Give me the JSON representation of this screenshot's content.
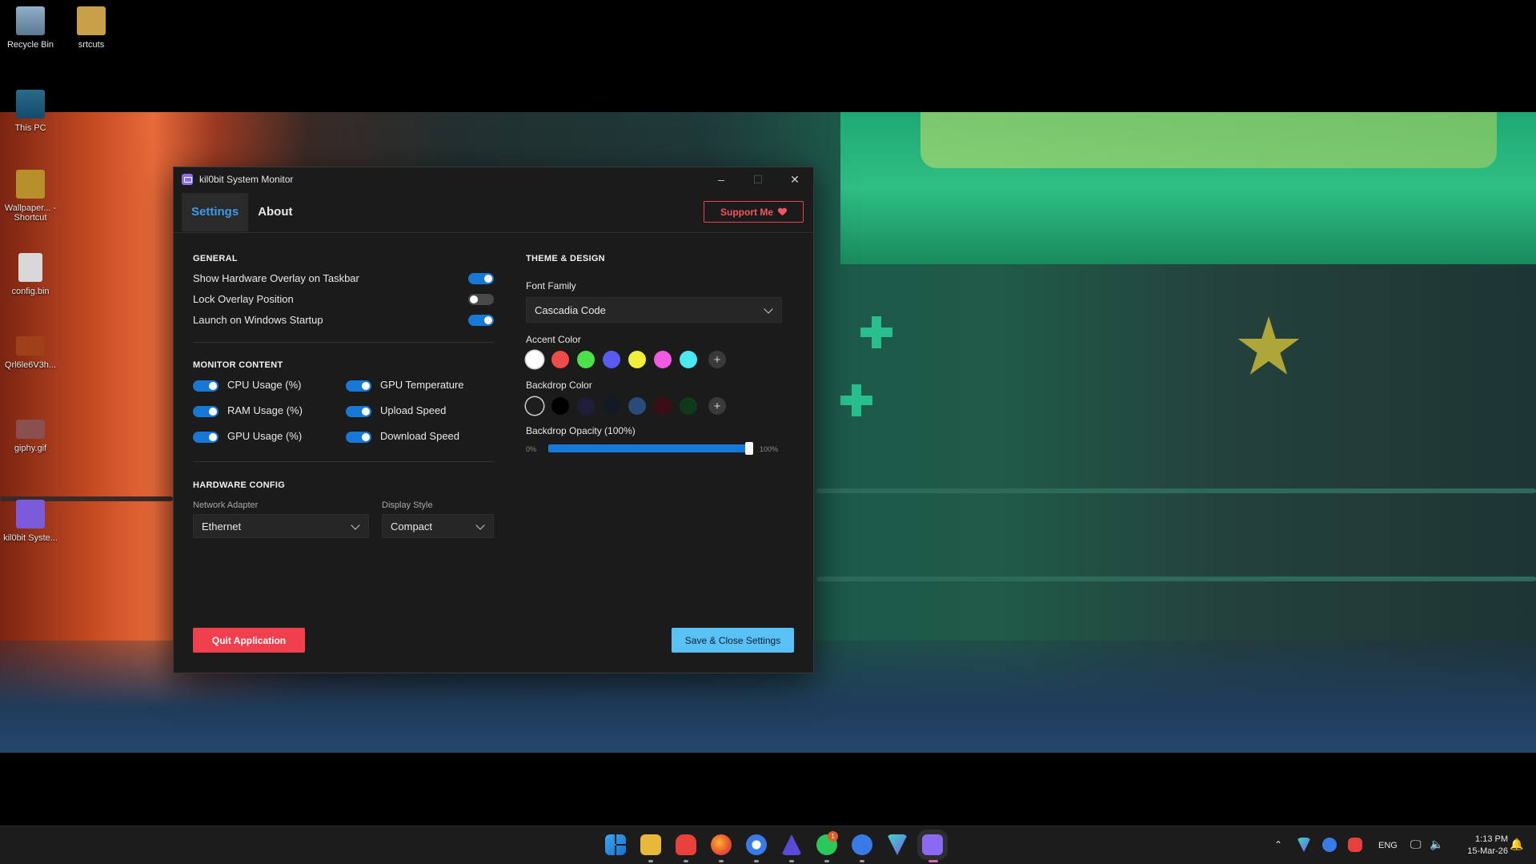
{
  "desktop": {
    "icons": [
      {
        "label": "Recycle Bin"
      },
      {
        "label": "srtcuts"
      },
      {
        "label": "This PC"
      },
      {
        "label": "Wallpaper... - Shortcut"
      },
      {
        "label": "config.bin"
      },
      {
        "label": "Qrl6le6V3h..."
      },
      {
        "label": "giphy.gif"
      },
      {
        "label": "kil0bit Syste..."
      }
    ]
  },
  "window": {
    "title": "kil0bit System Monitor",
    "controls": {
      "minimize": "–",
      "maximize": "☐",
      "close": "✕"
    }
  },
  "nav": {
    "tabs": [
      {
        "label": "Settings",
        "active": true
      },
      {
        "label": "About",
        "active": false
      }
    ],
    "support_label": "Support Me"
  },
  "general": {
    "title": "GENERAL",
    "options": [
      {
        "label": "Show Hardware Overlay on Taskbar",
        "on": true
      },
      {
        "label": "Lock Overlay Position",
        "on": false
      },
      {
        "label": "Launch on Windows Startup",
        "on": true
      }
    ]
  },
  "monitor": {
    "title": "MONITOR CONTENT",
    "left": [
      {
        "label": "CPU Usage (%)",
        "on": true
      },
      {
        "label": "RAM Usage (%)",
        "on": true
      },
      {
        "label": "GPU Usage (%)",
        "on": true
      }
    ],
    "right": [
      {
        "label": "GPU Temperature",
        "on": true
      },
      {
        "label": "Upload Speed",
        "on": true
      },
      {
        "label": "Download Speed",
        "on": true
      }
    ]
  },
  "hardware": {
    "title": "HARDWARE CONFIG",
    "network_label": "Network Adapter",
    "network_value": "Ethernet",
    "display_label": "Display Style",
    "display_value": "Compact"
  },
  "theme": {
    "title": "THEME & DESIGN",
    "font_label": "Font Family",
    "font_value": "Cascadia Code",
    "accent_label": "Accent Color",
    "accent_colors": [
      "#ffffff",
      "#f04a4a",
      "#4ce04a",
      "#5a5af0",
      "#f0f03a",
      "#f05ae0",
      "#4ae8f0"
    ],
    "backdrop_label": "Backdrop Color",
    "backdrop_colors": [
      "#1e1e1e",
      "#000000",
      "#1e1e3a",
      "#141a24",
      "#2a4a7a",
      "#3a0e12",
      "#0e3a18"
    ],
    "opacity_label": "Backdrop Opacity (100%)",
    "opacity_min": "0%",
    "opacity_max": "100%",
    "opacity_value": 100
  },
  "footer": {
    "quit_label": "Quit Application",
    "save_label": "Save & Close Settings"
  },
  "taskbar": {
    "lang": "ENG",
    "time": "1:13 PM",
    "date": "15-Mar-26",
    "whatsapp_badge": "1"
  }
}
